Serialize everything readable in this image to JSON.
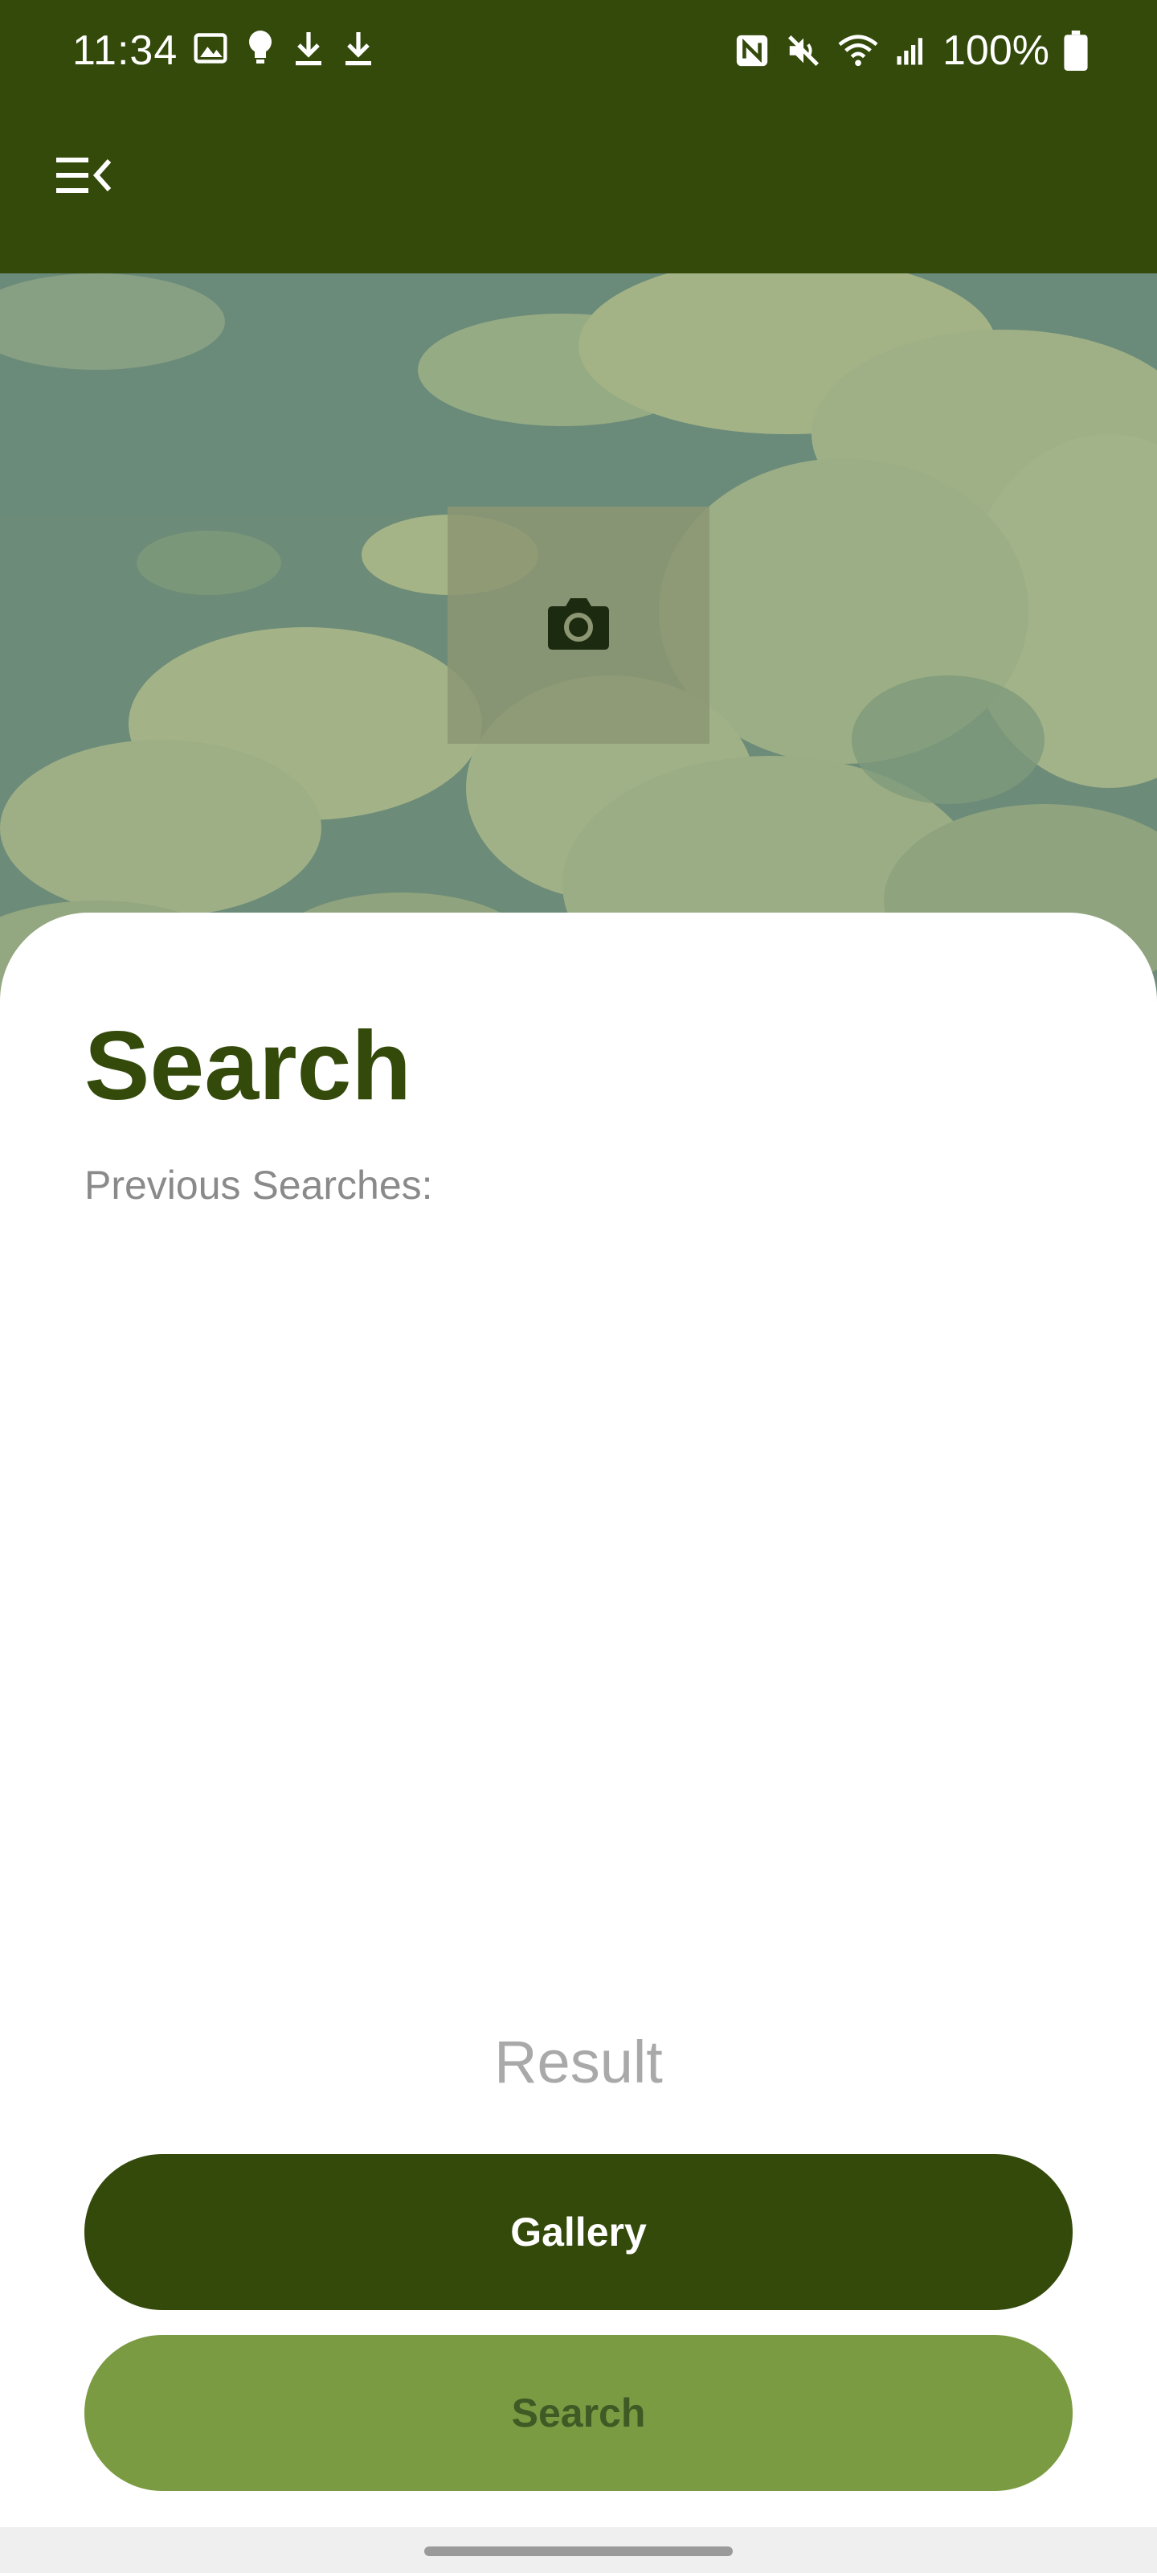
{
  "status_bar": {
    "time": "11:34",
    "battery_text": "100%",
    "left_icons": [
      "image-icon",
      "lightbulb-icon",
      "download-icon",
      "download-icon"
    ],
    "right_icons": [
      "nfc-icon",
      "mute-icon",
      "wifi-icon",
      "signal-icon",
      "battery-icon"
    ]
  },
  "app_bar": {
    "menu_icon": "menu-open-icon",
    "color": "#334a0b"
  },
  "hero": {
    "camera_icon": "camera-icon"
  },
  "sheet": {
    "title": "Search",
    "previous_label": "Previous Searches:",
    "result_label": "Result"
  },
  "buttons": {
    "gallery_label": "Gallery",
    "search_label": "Search"
  },
  "colors": {
    "primary": "#334a0b",
    "secondary": "#7b9b42",
    "muted_text": "#8a8a8a"
  }
}
